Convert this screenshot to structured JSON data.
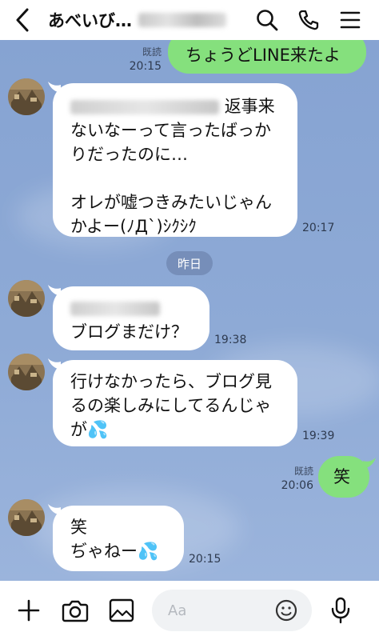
{
  "header": {
    "title": "あべいび…",
    "back_icon": "chevron-left-icon",
    "search_icon": "search-icon",
    "call_icon": "phone-icon",
    "menu_icon": "menu-icon"
  },
  "messages": [
    {
      "side": "out",
      "lines": [
        "ちょうどLINE来たよ"
      ],
      "read": "既読",
      "time": "20:15"
    },
    {
      "side": "in",
      "blur_prefix": true,
      "lines": [
        "返事来",
        "ないなーって言ったばっか",
        "りだったのに…",
        "",
        "オレが嘘つきみたいじゃん",
        "かよー(ﾉД`)ｼｸｼｸ"
      ],
      "time": "20:17"
    },
    {
      "side": "in",
      "blur_prefix": true,
      "lines": [
        "ブログまだけ？"
      ],
      "time": "19:38"
    },
    {
      "side": "in",
      "lines": [
        "行けなかったら、ブログ見",
        "るの楽しみにしてるんじゃ",
        "が💦"
      ],
      "time": "19:39"
    },
    {
      "side": "out",
      "lines": [
        "笑"
      ],
      "read": "既読",
      "time": "20:06"
    },
    {
      "side": "in",
      "lines": [
        "笑",
        "ぢゃねー💦"
      ],
      "time": "20:15"
    }
  ],
  "date_separator": "昨日",
  "footer": {
    "add_icon": "plus-icon",
    "camera_icon": "camera-icon",
    "image_icon": "image-icon",
    "input_placeholder": "Aa",
    "emoji_icon": "smiley-icon",
    "mic_icon": "microphone-icon"
  },
  "colors": {
    "header_bg": "#ffffff",
    "chat_bg": "#8aa4d0",
    "incoming_bubble": "#ffffff",
    "outgoing_bubble": "#85e07d"
  }
}
